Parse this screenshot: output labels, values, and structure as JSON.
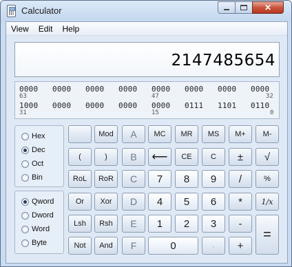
{
  "window": {
    "title": "Calculator"
  },
  "menubar": {
    "items": [
      "View",
      "Edit",
      "Help"
    ]
  },
  "display": {
    "value": "2147485654"
  },
  "bits": {
    "row1": [
      "0000",
      "0000",
      "0000",
      "0000",
      "0000",
      "0000",
      "0000",
      "0000"
    ],
    "row1_indices": [
      "63",
      "47",
      "32"
    ],
    "row2": [
      "1000",
      "0000",
      "0000",
      "0000",
      "0000",
      "0111",
      "1101",
      "0110"
    ],
    "row2_indices": [
      "31",
      "15",
      "0"
    ]
  },
  "base": {
    "options": [
      "Hex",
      "Dec",
      "Oct",
      "Bin"
    ],
    "selected": "Dec"
  },
  "word": {
    "options": [
      "Qword",
      "Dword",
      "Word",
      "Byte"
    ],
    "selected": "Qword"
  },
  "keys": {
    "blank": "",
    "mod": "Mod",
    "a": "A",
    "mc": "MC",
    "mr": "MR",
    "ms": "MS",
    "mplus": "M+",
    "mminus": "M-",
    "lparen": "(",
    "rparen": ")",
    "b": "B",
    "backspace": "⟵",
    "ce": "CE",
    "c": "C",
    "plusminus": "±",
    "sqrt": "√",
    "rol": "RoL",
    "ror": "RoR",
    "c_hex": "C",
    "seven": "7",
    "eight": "8",
    "nine": "9",
    "divide": "/",
    "percent": "%",
    "or": "Or",
    "xor": "Xor",
    "d": "D",
    "four": "4",
    "five": "5",
    "six": "6",
    "multiply": "*",
    "reciprocal": "1/x",
    "lsh": "Lsh",
    "rsh": "Rsh",
    "e": "E",
    "one": "1",
    "two": "2",
    "three": "3",
    "minus": "-",
    "equals": "=",
    "not": "Not",
    "and": "And",
    "f": "F",
    "zero": "0",
    "dot": ".",
    "plus": "+"
  },
  "titlebar_controls": {
    "close": "✕"
  }
}
